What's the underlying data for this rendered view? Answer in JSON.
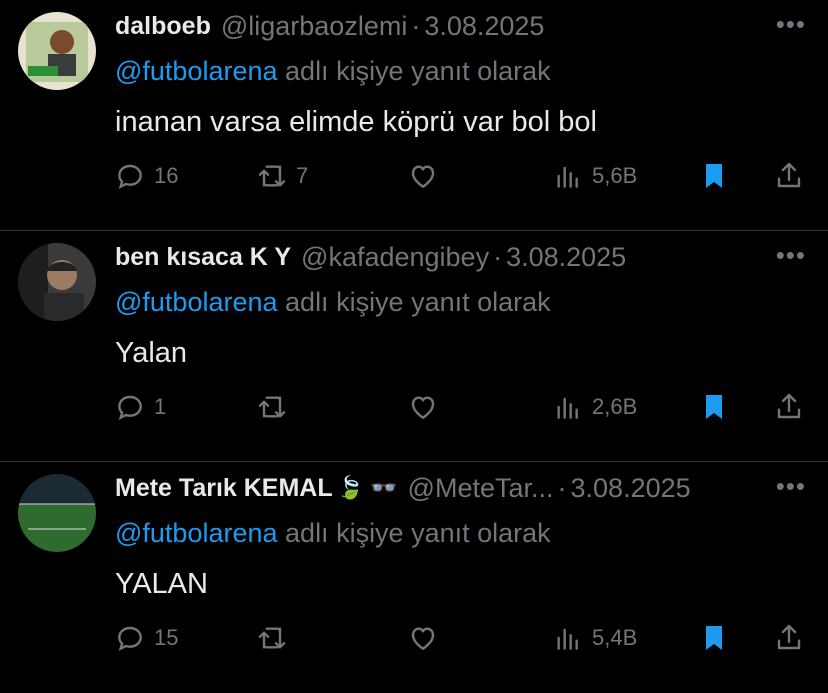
{
  "tweets": [
    {
      "name": "dalboeb",
      "emoji": "",
      "handle": "@ligarbaozlemi",
      "date": "3.08.2025",
      "mention": "@futbolarena",
      "reply_suffix": "adlı kişiye yanıt olarak",
      "text": "inanan varsa elimde köprü var bol bol",
      "replies": "16",
      "retweets": "7",
      "likes": "",
      "views": "5,6B"
    },
    {
      "name": "ben kısaca K Y",
      "emoji": "",
      "handle": "@kafadengibey",
      "date": "3.08.2025",
      "mention": "@futbolarena",
      "reply_suffix": "adlı kişiye yanıt olarak",
      "text": "Yalan",
      "replies": "1",
      "retweets": "",
      "likes": "",
      "views": "2,6B"
    },
    {
      "name": "Mete Tarık KEMAL",
      "emoji": "🍃 👓",
      "handle": "@MeteTar...",
      "date": "3.08.2025",
      "mention": "@futbolarena",
      "reply_suffix": "adlı kişiye yanıt olarak",
      "text": "YALAN",
      "replies": "15",
      "retweets": "",
      "likes": "",
      "views": "5,4B"
    }
  ],
  "sep": "·",
  "more_glyph": "•••",
  "colors": {
    "bg": "#000000",
    "text": "#e7e9ea",
    "muted": "#71767b",
    "accent": "#1d9bf0",
    "divider": "#2f3336"
  }
}
